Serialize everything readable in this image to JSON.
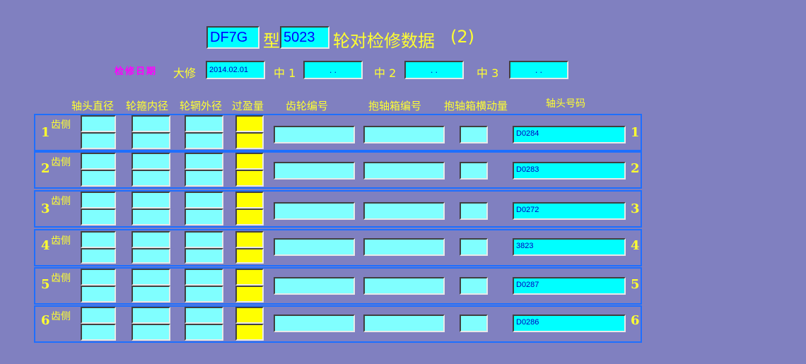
{
  "title": {
    "model_value": "DF7G",
    "model_suffix": "型",
    "number_value": "5023",
    "heading": "轮对检修数据",
    "page_no": "(2)"
  },
  "date_row": {
    "label": "检修日期",
    "overhaul_label": "大修",
    "overhaul_value": "2014.02.01",
    "mid1_label": "中 1",
    "mid1_value": ". .",
    "mid2_label": "中 2",
    "mid2_value": ". .",
    "mid3_label": "中 3",
    "mid3_value": ". ."
  },
  "columns": [
    "轴头直径",
    "轮箍内径",
    "轮辋外径",
    "过盈量",
    "齿轮编号",
    "抱轴箱编号",
    "抱轴箱横动量",
    "轴头号码"
  ],
  "rows": [
    {
      "num": "1",
      "side": "齿侧",
      "axle_code": "D0284"
    },
    {
      "num": "2",
      "side": "齿侧",
      "axle_code": "D0283"
    },
    {
      "num": "3",
      "side": "齿侧",
      "axle_code": "D0272"
    },
    {
      "num": "4",
      "side": "齿侧",
      "axle_code": "3823"
    },
    {
      "num": "5",
      "side": "齿侧",
      "axle_code": "D0287"
    },
    {
      "num": "6",
      "side": "齿侧",
      "axle_code": "D0286"
    }
  ],
  "colors": {
    "background": "#8080c0",
    "field": "#80ffff",
    "field_strong": "#00ffff",
    "interference_field": "#ffff00",
    "row_border": "#1e6fff",
    "label_text": "#ffff30",
    "date_label": "#ff00ff"
  }
}
